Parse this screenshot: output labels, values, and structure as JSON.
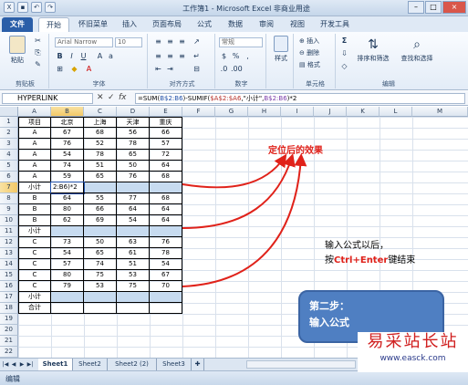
{
  "window": {
    "title": "工作簿1 - Microsoft Excel 非商业用途"
  },
  "tabs": [
    {
      "label": "文件"
    },
    {
      "label": "开始"
    },
    {
      "label": "怀旧菜单"
    },
    {
      "label": "插入"
    },
    {
      "label": "页面布局"
    },
    {
      "label": "公式"
    },
    {
      "label": "数据"
    },
    {
      "label": "审阅"
    },
    {
      "label": "视图"
    },
    {
      "label": "开发工具"
    }
  ],
  "ribbon": {
    "paste": "粘贴",
    "font_name": "Arial Narrow",
    "font_size": "10",
    "number_format": "常规",
    "styles": "样式",
    "insert": "插入",
    "delete": "删除",
    "format": "格式",
    "sort_filter": "排序和筛选",
    "find_select": "查找和选择",
    "groups": {
      "clipboard": "剪贴板",
      "font": "字体",
      "alignment": "对齐方式",
      "number": "数字",
      "cells": "单元格",
      "editing": "编辑"
    }
  },
  "formula_bar": {
    "name_box": "HYPERLINK",
    "fx": "fx",
    "formula": {
      "a": "=SUM(",
      "b": "B$2:B6",
      "c": ")-SUMIF(",
      "d": "$A$2:$A6",
      "e": ",\"小计\",",
      "f": "B$2:B6",
      "g": ")*2"
    }
  },
  "columns": [
    "A",
    "B",
    "C",
    "D",
    "E",
    "F",
    "G",
    "H",
    "I",
    "J",
    "K",
    "L",
    "M"
  ],
  "rows": [
    "1",
    "2",
    "3",
    "4",
    "5",
    "6",
    "7",
    "8",
    "9",
    "10",
    "11",
    "12",
    "13",
    "14",
    "15",
    "16",
    "17",
    "18",
    "19",
    "20",
    "21",
    "22",
    "23"
  ],
  "table": {
    "header": [
      "项目",
      "北京",
      "上海",
      "天津",
      "重庆"
    ],
    "rows": [
      [
        "A",
        "67",
        "68",
        "56",
        "66"
      ],
      [
        "A",
        "76",
        "52",
        "78",
        "57"
      ],
      [
        "A",
        "54",
        "78",
        "65",
        "72"
      ],
      [
        "A",
        "74",
        "51",
        "50",
        "64"
      ],
      [
        "A",
        "59",
        "65",
        "76",
        "68"
      ],
      [
        "小计",
        "2:B6)*2",
        "",
        "",
        ""
      ],
      [
        "B",
        "64",
        "55",
        "77",
        "68"
      ],
      [
        "B",
        "80",
        "66",
        "64",
        "64"
      ],
      [
        "B",
        "62",
        "69",
        "54",
        "64"
      ],
      [
        "小计",
        "",
        "",
        "",
        ""
      ],
      [
        "C",
        "73",
        "50",
        "63",
        "76"
      ],
      [
        "C",
        "54",
        "65",
        "61",
        "78"
      ],
      [
        "C",
        "57",
        "74",
        "51",
        "54"
      ],
      [
        "C",
        "80",
        "75",
        "53",
        "67"
      ],
      [
        "C",
        "79",
        "53",
        "75",
        "70"
      ],
      [
        "小计",
        "",
        "",
        "",
        ""
      ],
      [
        "合计",
        "",
        "",
        "",
        ""
      ]
    ]
  },
  "annotations": {
    "result": "定位后的效果",
    "instruction_line1": "输入公式以后，",
    "instruction_prefix": "按",
    "instruction_key": "Ctrl+Enter",
    "instruction_suffix": "键结束",
    "callout_line1": "第二步：",
    "callout_line2": "输入公式"
  },
  "watermark": {
    "line1": "易采站长站",
    "line2": "www.easck.com"
  },
  "sheet_tabs": [
    {
      "label": "Sheet1"
    },
    {
      "label": "Sheet2"
    },
    {
      "label": "Sheet2 (2)"
    },
    {
      "label": "Sheet3"
    }
  ],
  "status": {
    "mode": "编辑"
  },
  "colors": {
    "selection_band": "#c7dbf0",
    "annotation_red": "#e0221a",
    "callout_blue": "#4f7fc2"
  }
}
